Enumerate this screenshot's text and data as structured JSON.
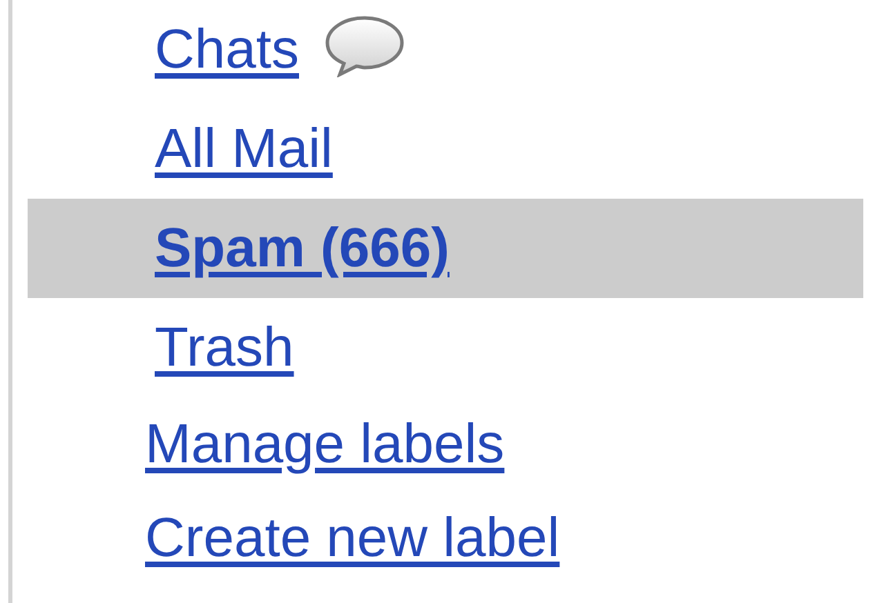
{
  "folders": [
    {
      "label": "Chats",
      "kind": "chat",
      "selected": false
    },
    {
      "label": "All Mail",
      "kind": "folder",
      "selected": false
    },
    {
      "label": "Spam (666)",
      "kind": "folder",
      "selected": true
    },
    {
      "label": "Trash",
      "kind": "folder",
      "selected": false
    }
  ],
  "links": [
    "Manage labels",
    "Create new label"
  ]
}
